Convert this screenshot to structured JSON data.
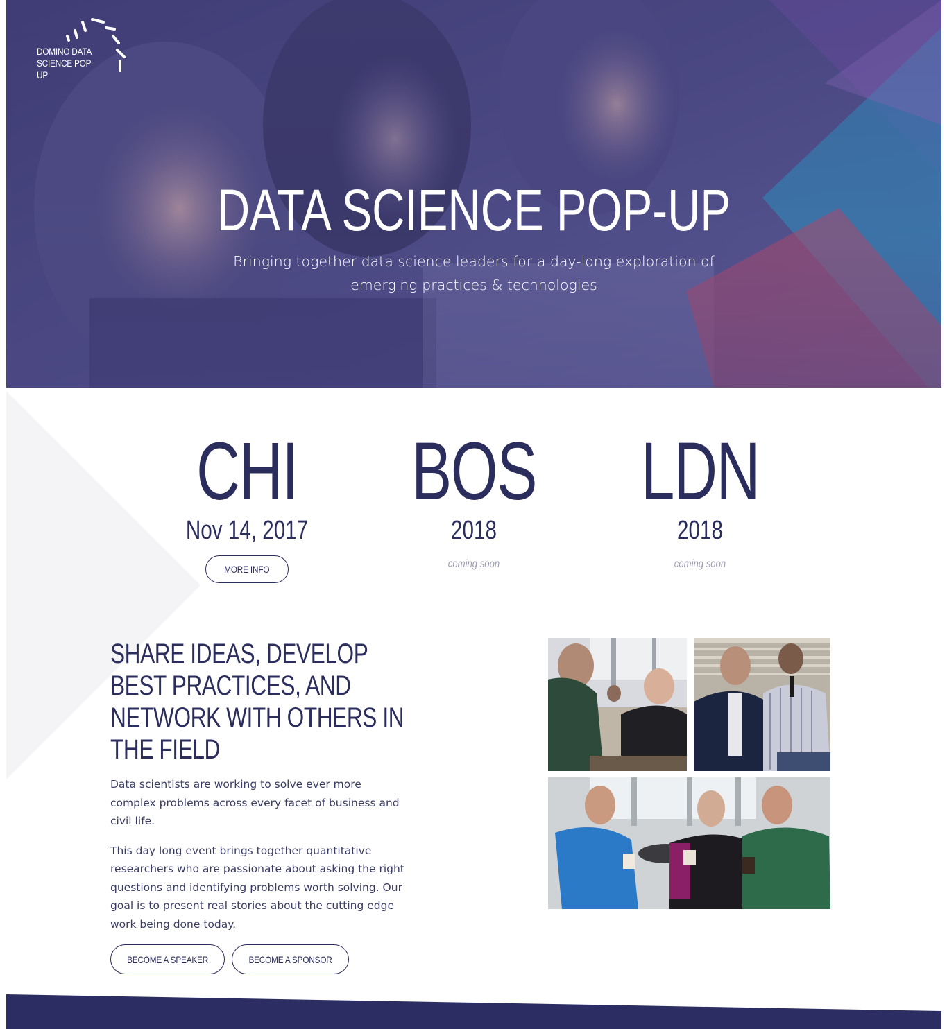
{
  "logo": {
    "line1": "DOMINO DATA",
    "line2": "SCIENCE POP-UP"
  },
  "hero": {
    "title": "DATA SCIENCE POP-UP",
    "subtitle": "Bringing together data science leaders for a day-long exploration of emerging practices & technologies"
  },
  "events": [
    {
      "code": "CHI",
      "date": "Nov 14, 2017",
      "action": "MORE INFO"
    },
    {
      "code": "BOS",
      "date": "2018",
      "status": "coming soon"
    },
    {
      "code": "LDN",
      "date": "2018",
      "status": "coming soon"
    }
  ],
  "info": {
    "heading": "SHARE IDEAS, DEVELOP BEST PRACTICES, AND NETWORK WITH OTHERS IN THE FIELD",
    "paragraph1": "Data scientists are working to solve ever more complex problems across every facet of business and civil life.",
    "paragraph2": "This day long event brings together quantitative researchers who are passionate about asking the right questions and identifying problems worth solving. Our goal is to present real stories about the cutting edge work being done today.",
    "speaker_button": "BECOME A SPEAKER",
    "sponsor_button": "BECOME A SPONSOR"
  },
  "colors": {
    "navy": "#2b2d5c",
    "hero_purple": "#5a5793",
    "accent_blue": "#2f88b8",
    "accent_red": "#b0486a",
    "muted": "#9c9cb0"
  }
}
